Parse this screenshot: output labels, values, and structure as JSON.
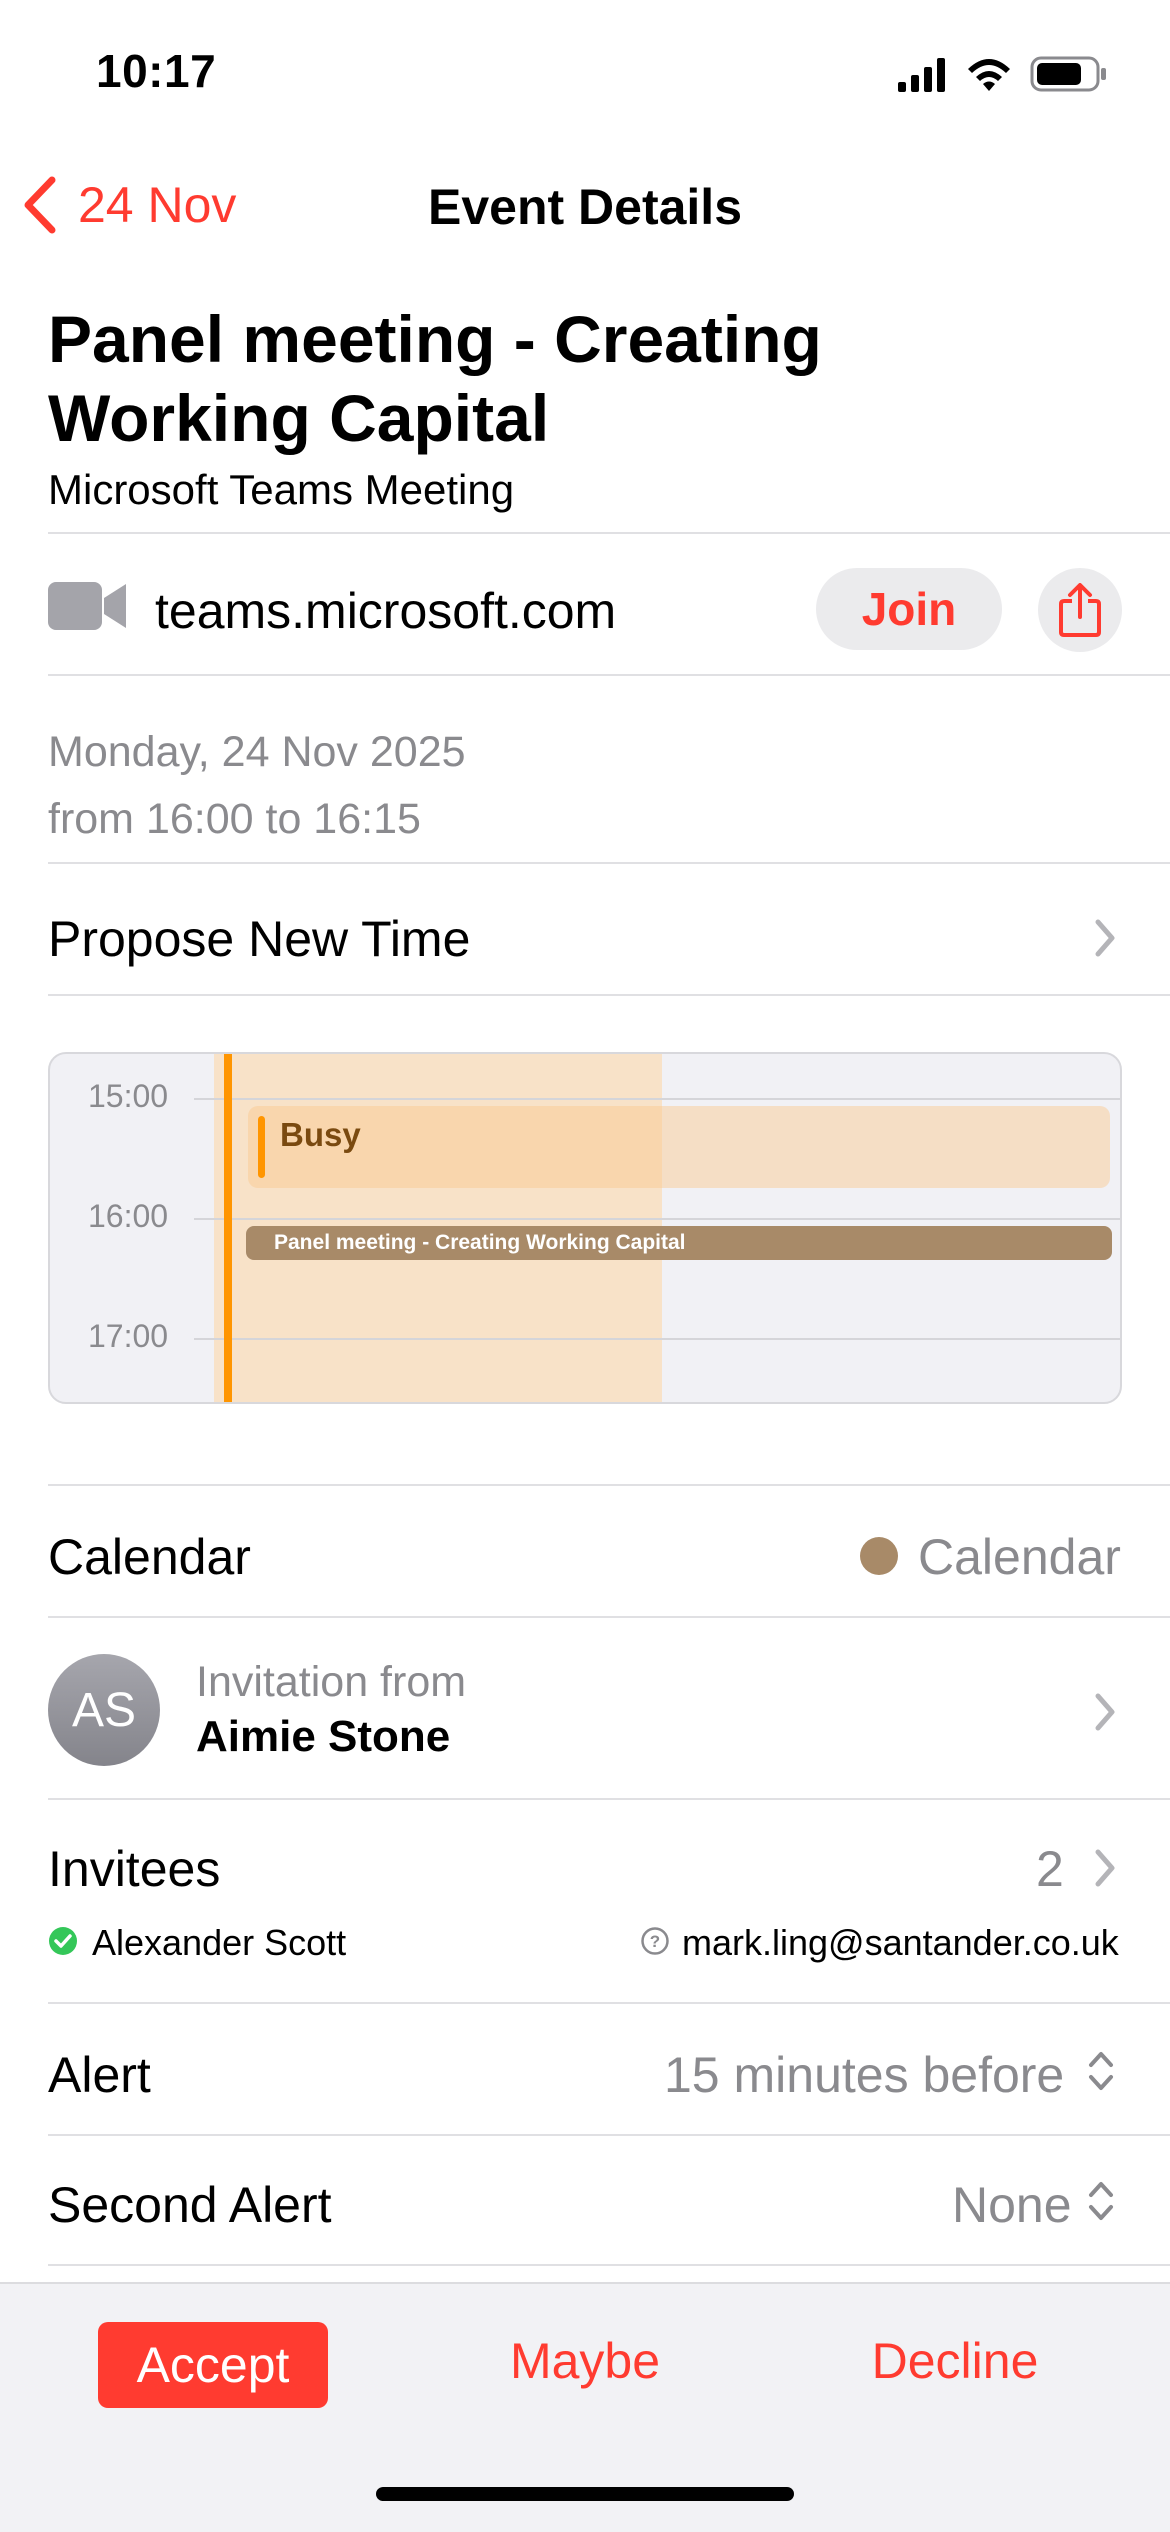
{
  "status_bar": {
    "time": "10:17"
  },
  "nav": {
    "back_label": "24 Nov",
    "title": "Event Details"
  },
  "event": {
    "title": "Panel meeting - Creating Working Capital",
    "subtitle": "Microsoft Teams Meeting",
    "url": "teams.microsoft.com",
    "join_label": "Join",
    "date": "Monday, 24 Nov 2025",
    "time_range": "from 16:00 to 16:15"
  },
  "propose_new_time": {
    "label": "Propose New Time"
  },
  "day_preview": {
    "hours": [
      "15:00",
      "16:00",
      "17:00"
    ],
    "busy_label": "Busy",
    "event_label": "Panel meeting - Creating Working Capital"
  },
  "calendar_row": {
    "label": "Calendar",
    "value": "Calendar",
    "color": "#a88a68"
  },
  "invitation": {
    "avatar_initials": "AS",
    "label": "Invitation from",
    "name": "Aimie Stone"
  },
  "invitees": {
    "label": "Invitees",
    "count": "2",
    "people": [
      {
        "name": "Alexander Scott",
        "status": "accepted"
      },
      {
        "name": "mark.ling@santander.co.uk",
        "status": "unknown"
      }
    ]
  },
  "alert": {
    "label": "Alert",
    "value": "15 minutes before"
  },
  "second_alert": {
    "label": "Second Alert",
    "value": "None"
  },
  "actions": {
    "accept": "Accept",
    "maybe": "Maybe",
    "decline": "Decline"
  },
  "colors": {
    "accent": "#ff3b30",
    "busy": "#ff9500",
    "accepted": "#34c759"
  }
}
